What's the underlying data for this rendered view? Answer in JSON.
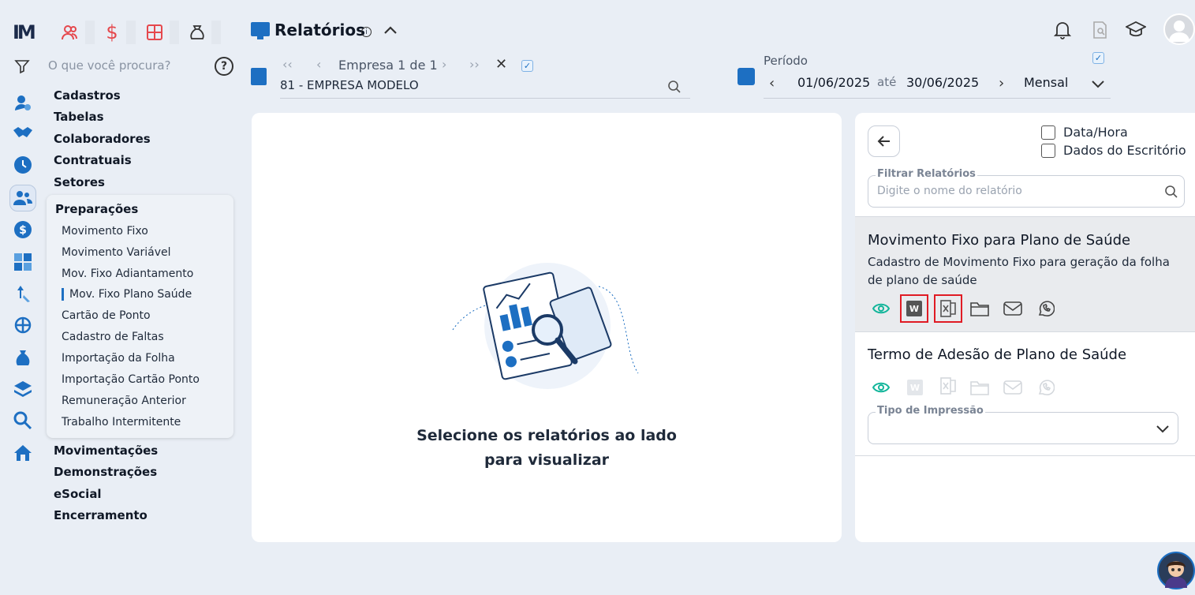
{
  "toolbar": {
    "logo": "IM",
    "icons": [
      "users-icon",
      "dollar-icon",
      "calculator-icon",
      "money-bag-icon"
    ]
  },
  "sidebar": {
    "search_placeholder": "O que você procura?",
    "help": "?",
    "menu_top": [
      "Cadastros",
      "Tabelas",
      "Colaboradores",
      "Contratuais",
      "Setores"
    ],
    "submenu_title": "Preparações",
    "submenu_items": [
      "Movimento Fixo",
      "Movimento Variável",
      "Mov. Fixo Adiantamento",
      "Mov. Fixo Plano Saúde",
      "Cartão de Ponto",
      "Cadastro de Faltas",
      "Importação da Folha",
      "Importação Cartão Ponto",
      "Remuneração Anterior",
      "Trabalho Intermitente"
    ],
    "menu_bottom": [
      "Movimentações",
      "Demonstrações",
      "eSocial",
      "Encerramento"
    ]
  },
  "header": {
    "title": "Relatórios",
    "info": "i",
    "empresa_nav_label": "Empresa 1 de 1",
    "empresa_value": "81 - EMPRESA MODELO",
    "periodo_label": "Período",
    "date_start": "01/06/2025",
    "ate": "até",
    "date_end": "30/06/2025",
    "period_type": "Mensal"
  },
  "center": {
    "line1": "Selecione os relatórios ao lado",
    "line2": "para visualizar"
  },
  "right": {
    "checkbox_datahora": "Data/Hora",
    "checkbox_escritorio": "Dados do Escritório",
    "filter_label": "Filtrar Relatórios",
    "filter_placeholder": "Digite o nome do relatório",
    "report1_title": "Movimento Fixo para Plano de Saúde",
    "report1_desc": "Cadastro de Movimento Fixo para geração da folha de plano de saúde",
    "report2_title": "Termo de Adesão de Plano de Saúde",
    "tipo_impressao_label": "Tipo de Impressão",
    "w_letter": "W"
  },
  "colors": {
    "accent": "#1d6fc2",
    "highlight": "#e01b24",
    "eye": "#12b59a"
  }
}
